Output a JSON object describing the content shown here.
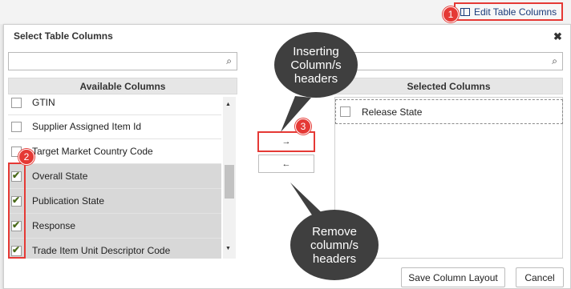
{
  "toolbar": {
    "edit_table_columns": "Edit Table Columns"
  },
  "dialog": {
    "title": "Select Table Columns",
    "close_glyph": "✖"
  },
  "available": {
    "header": "Available Columns",
    "search_value": "",
    "items": [
      {
        "label": "GTIN",
        "checked": false
      },
      {
        "label": "Supplier Assigned Item Id",
        "checked": false
      },
      {
        "label": "Target Market Country Code",
        "checked": false
      },
      {
        "label": "Overall State",
        "checked": true
      },
      {
        "label": "Publication State",
        "checked": true
      },
      {
        "label": "Response",
        "checked": true
      },
      {
        "label": "Trade Item Unit Descriptor Code",
        "checked": true
      }
    ]
  },
  "selected": {
    "header": "Selected Columns",
    "search_value": "",
    "items": [
      {
        "label": "Release State",
        "checked": false
      }
    ]
  },
  "buttons": {
    "move_right": "→",
    "move_left": "←",
    "save_layout": "Save Column Layout",
    "cancel": "Cancel"
  },
  "callouts": {
    "insert": "Inserting Column/s headers",
    "remove": "Remove column/s headers",
    "badge1": "1",
    "badge2": "2",
    "badge3": "3"
  },
  "colors": {
    "accent_red": "#e53935",
    "bubble_dark": "#3f3f3f",
    "selected_row": "#d8d8d8"
  }
}
